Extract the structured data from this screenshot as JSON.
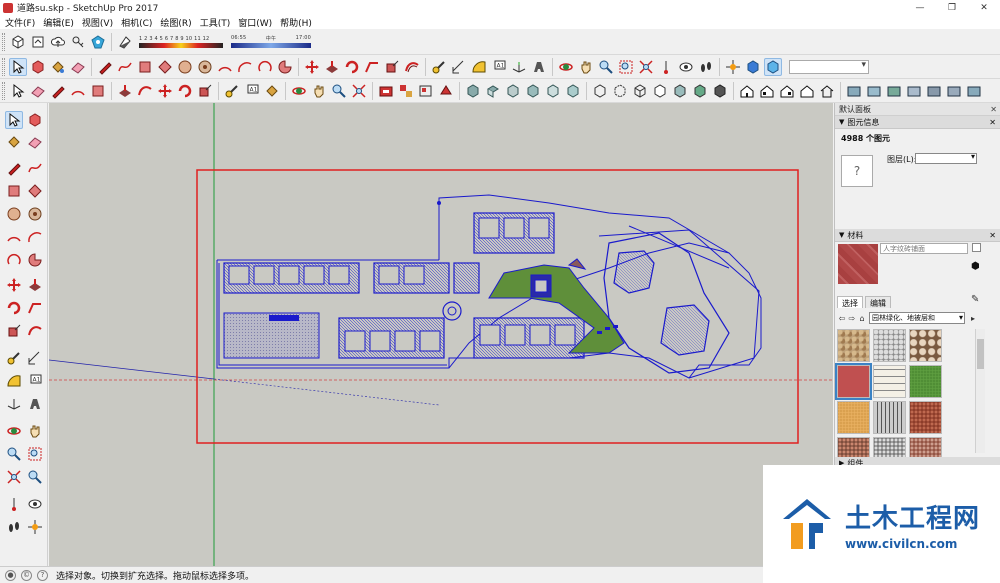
{
  "window": {
    "title": "道路su.skp - SketchUp Pro 2017",
    "controls": [
      "—",
      "❐",
      "✕"
    ]
  },
  "menu": [
    "文件(F)",
    "编辑(E)",
    "视图(V)",
    "相机(C)",
    "绘图(R)",
    "工具(T)",
    "窗口(W)",
    "帮助(H)"
  ],
  "shadow_widget": {
    "months": "1 2 3 4 5 6 7 8 9 10 11 12",
    "time_start": "06:55",
    "time_mid": "中午",
    "time_end": "17:00"
  },
  "right_panel": {
    "tray_title": "默认面板",
    "entity_info": {
      "title": "图元信息",
      "count": "4988 个图元",
      "placeholder": "?",
      "layer_label": "图层(L):"
    },
    "materials": {
      "title": "材料",
      "current_name": "人字纹砖铺面",
      "tabs": [
        "选择",
        "编辑"
      ],
      "library": "园林绿化、地被层和",
      "next_section": "组件"
    }
  },
  "status": {
    "text": "选择对象。切换到扩充选择。拖动鼠标选择多项。"
  },
  "watermark": {
    "title": "土木工程网",
    "url": "www.civilcn.com"
  },
  "colors": {
    "viewport_bg": "#c9c9c3",
    "model_blue": "#1a1acc",
    "selection_red": "#e02020",
    "grass": "#5f8f3a",
    "brand_blue": "#1c5da8"
  }
}
